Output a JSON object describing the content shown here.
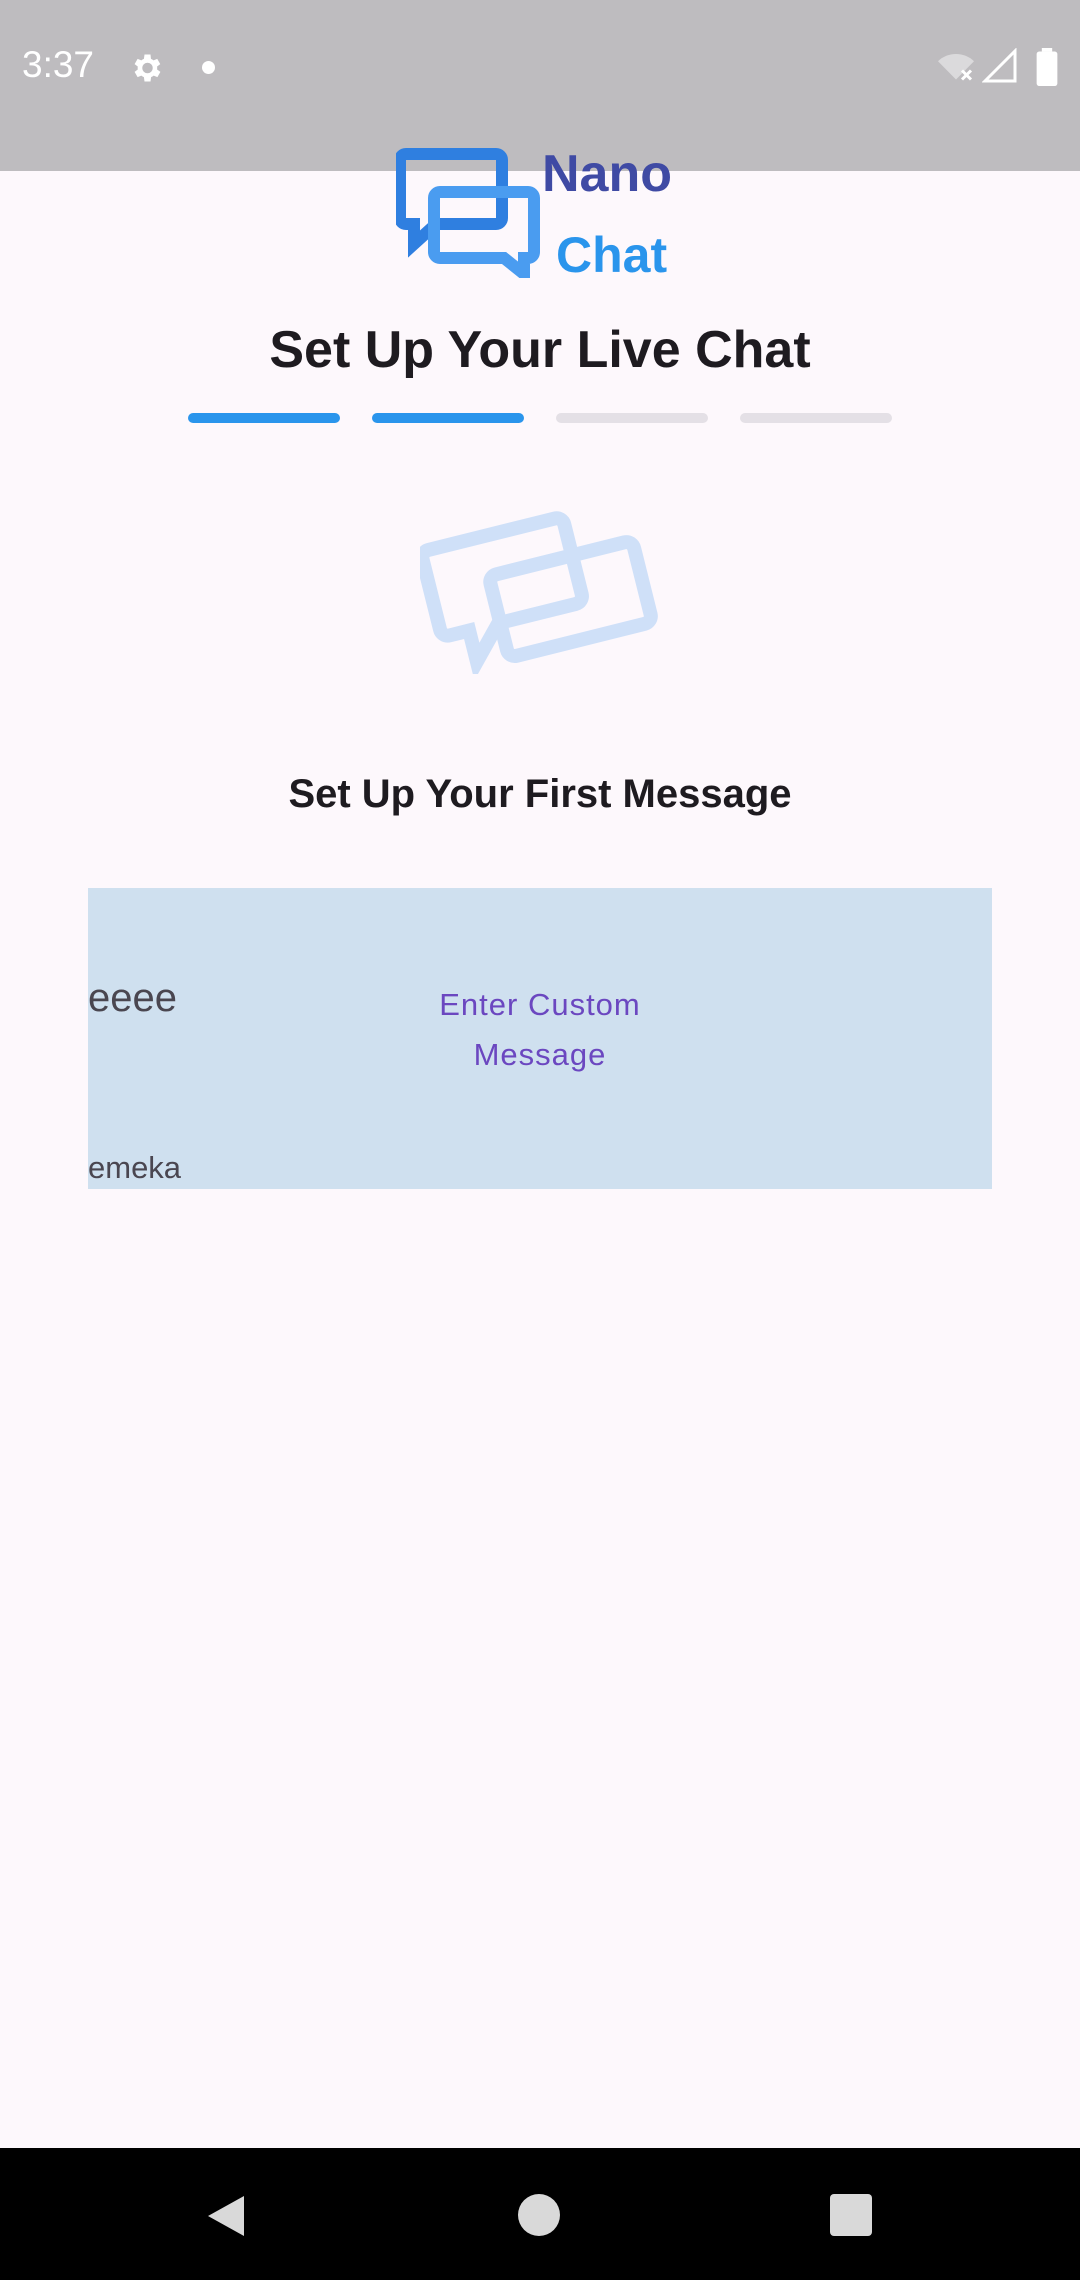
{
  "status_bar": {
    "time": "3:37",
    "icons": [
      "gear-icon",
      "notification-dot-icon",
      "wifi-off-icon",
      "signal-icon",
      "battery-icon"
    ]
  },
  "logo": {
    "line1": "Nano",
    "line2": "Chat",
    "icon": "chat-bubbles-icon"
  },
  "page_title": "Set Up Your Live Chat",
  "progress": {
    "total_steps": 4,
    "completed_steps": 2,
    "active_color": "#2a95ec",
    "inactive_color": "#e4e0e6"
  },
  "hero_icon": "chat-bubbles-icon",
  "section_title": "Set Up Your First Message",
  "message_card": {
    "preview_text": "eeee",
    "sender_name": "emeka",
    "custom_button_label": "Enter Custom Message",
    "background": "#cfe0ef"
  },
  "nav_bar": {
    "icons": [
      "back-icon",
      "home-icon",
      "recents-icon"
    ]
  },
  "colors": {
    "background": "#fdf8fc",
    "brand_dark": "#3f4aa4",
    "brand_light": "#2a95ec",
    "accent_purple": "#6b47c0"
  }
}
